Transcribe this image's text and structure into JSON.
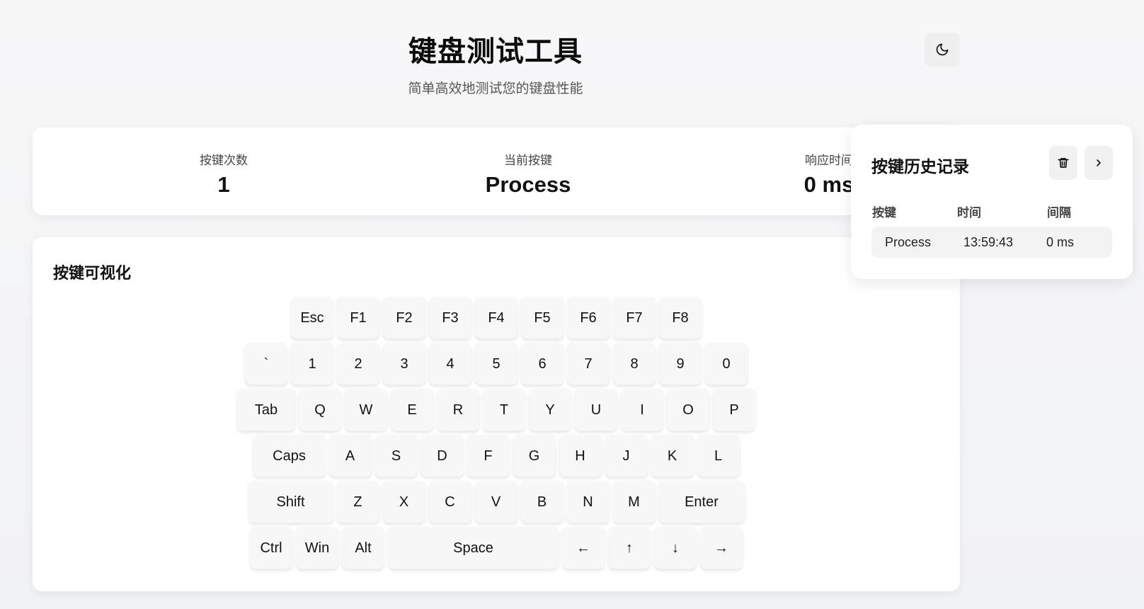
{
  "header": {
    "title": "键盘测试工具",
    "subtitle": "简单高效地测试您的键盘性能",
    "theme_toggle_icon": "moon-icon"
  },
  "stats": {
    "count_label": "按键次数",
    "count_value": "1",
    "current_label": "当前按键",
    "current_value": "Process",
    "response_label": "响应时间",
    "response_value": "0 ms"
  },
  "visualizer": {
    "title": "按键可视化",
    "rows": [
      [
        "Esc",
        "F1",
        "F2",
        "F3",
        "F4",
        "F5",
        "F6",
        "F7",
        "F8"
      ],
      [
        "`",
        "1",
        "2",
        "3",
        "4",
        "5",
        "6",
        "7",
        "8",
        "9",
        "0"
      ],
      [
        "Tab",
        "Q",
        "W",
        "E",
        "R",
        "T",
        "Y",
        "U",
        "I",
        "O",
        "P"
      ],
      [
        "Caps",
        "A",
        "S",
        "D",
        "F",
        "G",
        "H",
        "J",
        "K",
        "L"
      ],
      [
        "Shift",
        "Z",
        "X",
        "C",
        "V",
        "B",
        "N",
        "M",
        "Enter"
      ],
      [
        "Ctrl",
        "Win",
        "Alt",
        "Space",
        "←",
        "↑",
        "↓",
        "→"
      ]
    ]
  },
  "history": {
    "title": "按键历史记录",
    "clear_icon": "trash-icon",
    "collapse_icon": "chevron-right-icon",
    "columns": [
      "按键",
      "时间",
      "间隔"
    ],
    "rows": [
      {
        "key": "Process",
        "time": "13:59:43",
        "interval": "0 ms"
      }
    ]
  }
}
